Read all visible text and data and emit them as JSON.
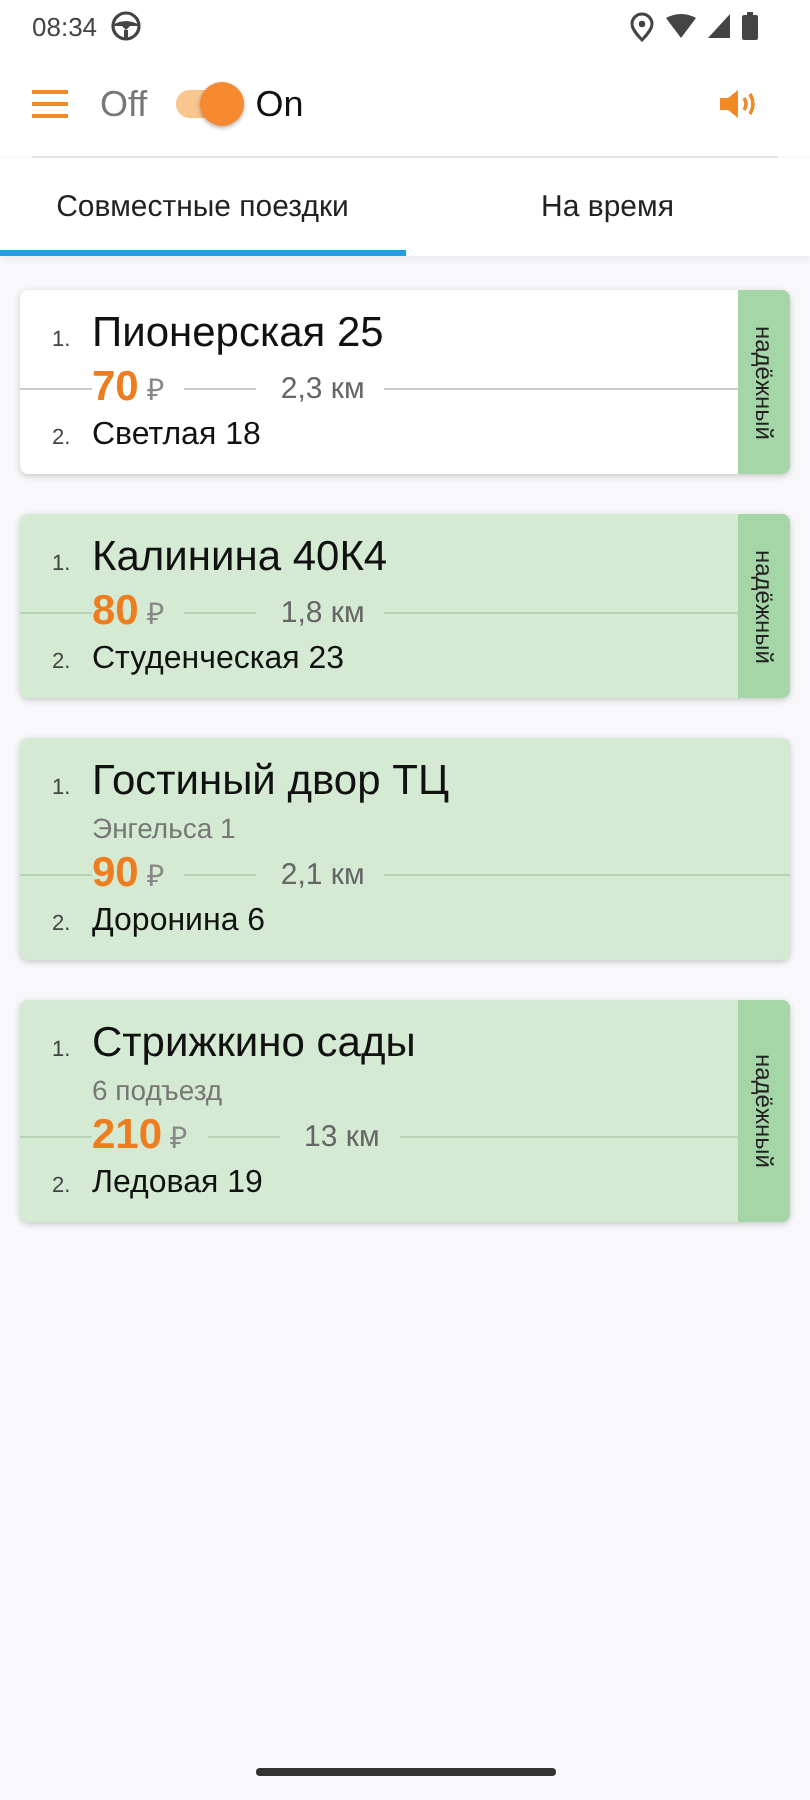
{
  "status_bar": {
    "time": "08:34"
  },
  "toolbar": {
    "off_label": "Off",
    "on_label": "On",
    "switch_on": true
  },
  "tabs": [
    {
      "label": "Совместные поездки",
      "selected": true
    },
    {
      "label": "На время",
      "selected": false
    }
  ],
  "rides": [
    {
      "highlighted": false,
      "from_index": "1.",
      "from": "Пионерская 25",
      "price": "70",
      "currency": "₽",
      "distance": "2,3 км",
      "to_index": "2.",
      "to": "Светлая 18",
      "badge": "надёжный"
    },
    {
      "highlighted": true,
      "from_index": "1.",
      "from": "Калинина 40К4",
      "price": "80",
      "currency": "₽",
      "distance": "1,8 км",
      "to_index": "2.",
      "to": "Студенческая 23",
      "badge": "надёжный"
    },
    {
      "highlighted": true,
      "from_index": "1.",
      "from": "Гостиный двор ТЦ",
      "from_note": "Энгельса 1",
      "price": "90",
      "currency": "₽",
      "distance": "2,1 км",
      "to_index": "2.",
      "to": "Доронина 6"
    },
    {
      "highlighted": true,
      "from_index": "1.",
      "from": "Стрижкино сады",
      "from_note": "6 подъезд",
      "price": "210",
      "currency": "₽",
      "distance": "13 км",
      "to_index": "2.",
      "to": "Ледовая 19",
      "badge": "надёжный"
    }
  ]
}
